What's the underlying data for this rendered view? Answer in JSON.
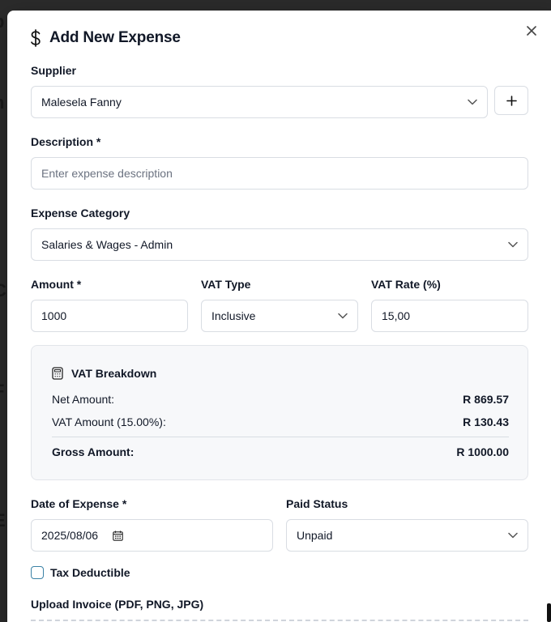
{
  "modal": {
    "title": "Add New Expense",
    "title_icon": "dollar-sign-icon",
    "close_icon": "close-icon"
  },
  "supplier": {
    "label": "Supplier",
    "value": "Malesela Fanny",
    "add_icon": "plus-icon"
  },
  "description": {
    "label": "Description *",
    "value": "",
    "placeholder": "Enter expense description"
  },
  "category": {
    "label": "Expense Category",
    "value": "Salaries & Wages - Admin"
  },
  "amount": {
    "label": "Amount *",
    "value": "1000"
  },
  "vat_type": {
    "label": "VAT Type",
    "value": "Inclusive"
  },
  "vat_rate": {
    "label": "VAT Rate (%)",
    "value": "15,00"
  },
  "vat_breakdown": {
    "title": "VAT Breakdown",
    "icon": "calculator-icon",
    "net_label": "Net Amount:",
    "net_value": "R 869.57",
    "vat_label": "VAT Amount (15.00%):",
    "vat_value": "R 130.43",
    "gross_label": "Gross Amount:",
    "gross_value": "R 1000.00"
  },
  "date": {
    "label": "Date of Expense *",
    "value": "2025/08/06",
    "icon": "calendar-icon"
  },
  "paid_status": {
    "label": "Paid Status",
    "value": "Unpaid"
  },
  "tax_deductible": {
    "label": "Tax Deductible",
    "checked": false
  },
  "upload": {
    "label": "Upload Invoice (PDF, PNG, JPG)"
  },
  "colors": {
    "checkbox_border": "#3b82a6",
    "panel_bg": "#f7f8fa",
    "border": "#d9dde3"
  }
}
